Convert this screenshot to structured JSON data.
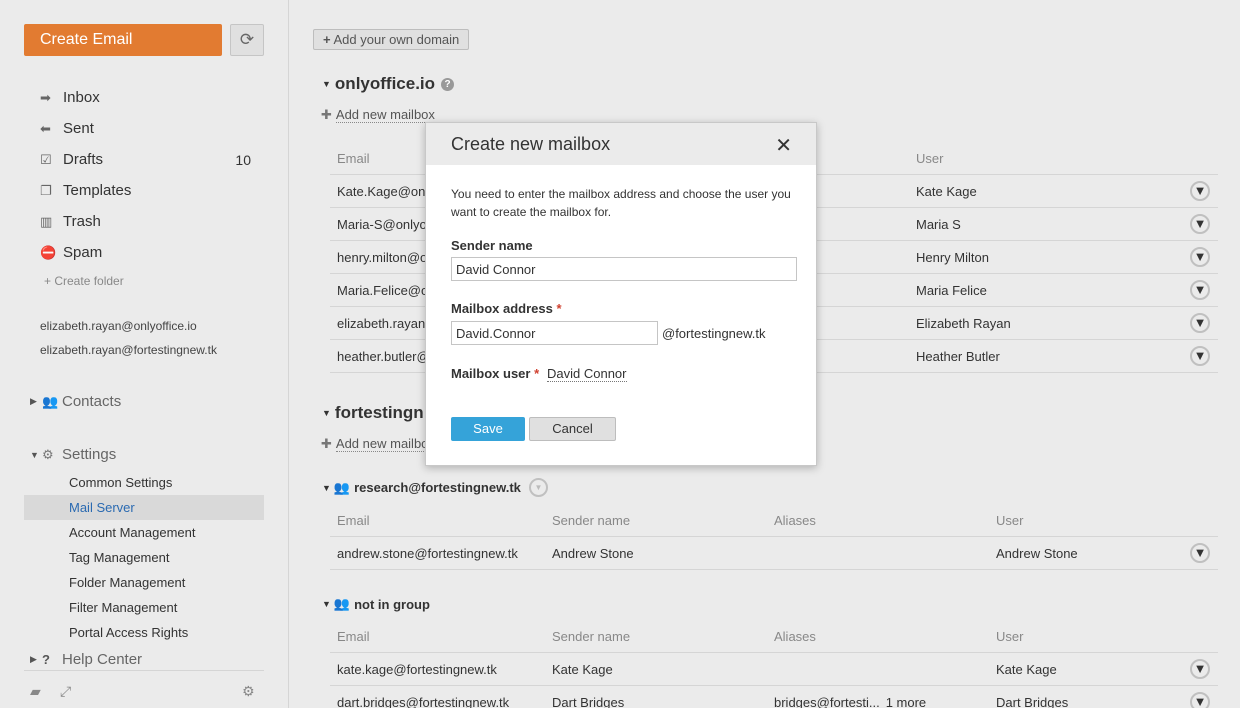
{
  "sidebar": {
    "create_email": "Create Email",
    "refresh_icon": "refresh-icon",
    "nav": [
      {
        "icon": "arrow-right-icon",
        "label": "Inbox",
        "count": ""
      },
      {
        "icon": "reply-icon",
        "label": "Sent",
        "count": ""
      },
      {
        "icon": "edit-icon",
        "label": "Drafts",
        "count": "10"
      },
      {
        "icon": "copy-icon",
        "label": "Templates",
        "count": ""
      },
      {
        "icon": "trash-icon",
        "label": "Trash",
        "count": ""
      },
      {
        "icon": "block-icon",
        "label": "Spam",
        "count": ""
      }
    ],
    "create_folder": "Create folder",
    "accounts": [
      "elizabeth.rayan@onlyoffice.io",
      "elizabeth.rayan@fortestingnew.tk"
    ],
    "contacts": "Contacts",
    "settings": "Settings",
    "settings_items": [
      "Common Settings",
      "Mail Server",
      "Account Management",
      "Tag Management",
      "Folder Management",
      "Filter Management",
      "Portal Access Rights"
    ],
    "help_center": "Help Center"
  },
  "main": {
    "add_domain": "Add your own domain",
    "domain1": {
      "name": "onlyoffice.io",
      "add_mailbox": "Add new mailbox",
      "headers": {
        "email": "Email",
        "user": "User"
      },
      "rows": [
        {
          "email": "Kate.Kage@only",
          "user": "Kate Kage"
        },
        {
          "email": "Maria-S@onlyof",
          "user": "Maria S"
        },
        {
          "email": "henry.milton@o",
          "user": "Henry Milton"
        },
        {
          "email": "Maria.Felice@or",
          "user": "Maria Felice"
        },
        {
          "email": "elizabeth.rayan",
          "user": "Elizabeth Rayan"
        },
        {
          "email": "heather.butler@",
          "user": "Heather Butler"
        }
      ]
    },
    "domain2": {
      "name": "fortestingn",
      "add_mailbox": "Add new mailbo",
      "headers": {
        "email": "Email",
        "sender": "Sender name",
        "aliases": "Aliases",
        "user": "User"
      },
      "group1": {
        "name": "research@fortestingnew.tk",
        "rows": [
          {
            "email": "andrew.stone@fortestingnew.tk",
            "sender": "Andrew Stone",
            "aliases": "",
            "more": "",
            "user": "Andrew Stone"
          }
        ]
      },
      "group2": {
        "name": "not in group",
        "rows": [
          {
            "email": "kate.kage@fortestingnew.tk",
            "sender": "Kate Kage",
            "aliases": "",
            "more": "",
            "user": "Kate Kage"
          },
          {
            "email": "dart.bridges@fortestingnew.tk",
            "sender": "Dart Bridges",
            "aliases": "bridges@fortesti...",
            "more": "1 more",
            "user": "Dart Bridges"
          }
        ]
      }
    }
  },
  "dialog": {
    "title": "Create new mailbox",
    "description": "You need to enter the mailbox address and choose the user you want to create the mailbox for.",
    "sender_label": "Sender name",
    "sender_value": "David Connor",
    "address_label": "Mailbox address",
    "address_value": "David.Connor",
    "domain_suffix": "@fortestingnew.tk",
    "user_label": "Mailbox user",
    "user_value": "David Connor",
    "required_mark": "*",
    "save": "Save",
    "cancel": "Cancel"
  }
}
